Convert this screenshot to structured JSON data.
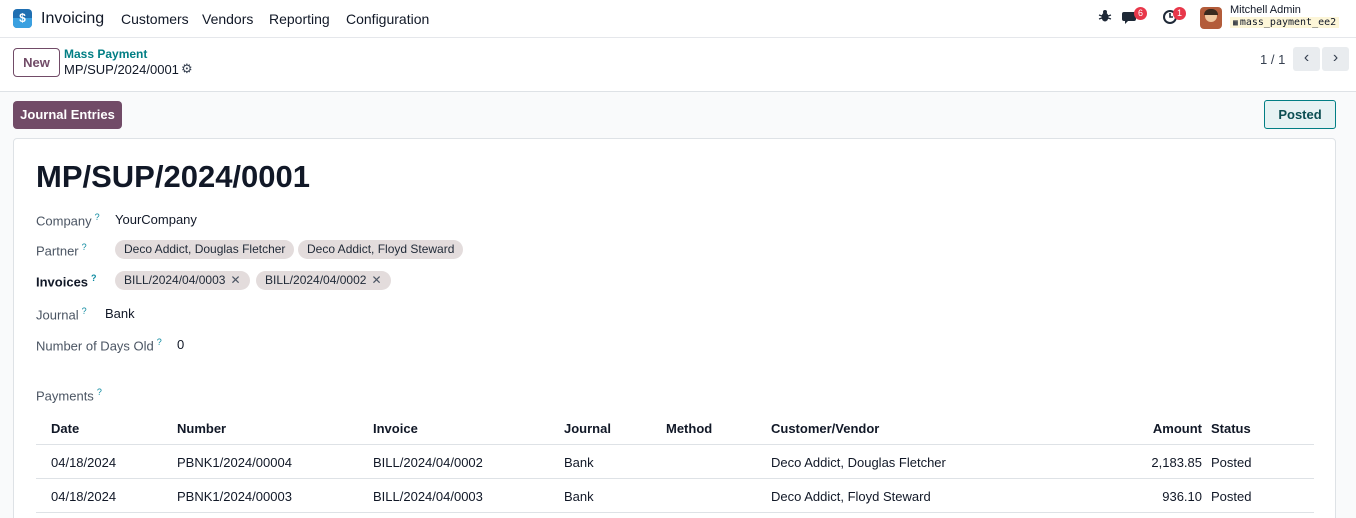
{
  "navbar": {
    "app_name": "Invoicing",
    "app_icon_letter": "$",
    "menu": [
      "Customers",
      "Vendors",
      "Reporting",
      "Configuration"
    ],
    "messages_count": "6",
    "activities_count": "1",
    "user_name": "Mitchell Admin",
    "database": "mass_payment_ee2"
  },
  "control_panel": {
    "new_label": "New",
    "breadcrumb_parent": "Mass Payment",
    "breadcrumb_current": "MP/SUP/2024/0001",
    "pager": "1 / 1"
  },
  "statusbar": {
    "journal_entries_label": "Journal Entries",
    "status": "Posted"
  },
  "form": {
    "title": "MP/SUP/2024/0001",
    "fields": {
      "company_label": "Company",
      "company_value": "YourCompany",
      "partner_label": "Partner",
      "partners": [
        "Deco Addict, Douglas Fletcher",
        "Deco Addict, Floyd Steward"
      ],
      "invoices_label": "Invoices",
      "invoices": [
        "BILL/2024/04/0003",
        "BILL/2024/04/0002"
      ],
      "journal_label": "Journal",
      "journal_value": "Bank",
      "days_old_label": "Number of Days Old",
      "days_old_value": "0",
      "help_mark": "?"
    },
    "payments": {
      "label": "Payments",
      "columns": [
        "Date",
        "Number",
        "Invoice",
        "Journal",
        "Method",
        "Customer/Vendor",
        "Amount",
        "Status"
      ],
      "rows": [
        {
          "date": "04/18/2024",
          "number": "PBNK1/2024/00004",
          "invoice": "BILL/2024/04/0002",
          "journal": "Bank",
          "method": "",
          "partner": "Deco Addict, Douglas Fletcher",
          "amount": "2,183.85",
          "status": "Posted"
        },
        {
          "date": "04/18/2024",
          "number": "PBNK1/2024/00003",
          "invoice": "BILL/2024/04/0003",
          "journal": "Bank",
          "method": "",
          "partner": "Deco Addict, Floyd Steward",
          "amount": "936.10",
          "status": "Posted"
        }
      ]
    }
  },
  "colors": {
    "primary": "#714b67",
    "accent": "#017e84",
    "badge": "#e8374a"
  },
  "icons": [
    "app-icon",
    "bug-icon",
    "chat-icon",
    "clock-icon",
    "gear-icon",
    "chevron-left-icon",
    "chevron-right-icon",
    "remove-tag-icon",
    "database-icon"
  ]
}
